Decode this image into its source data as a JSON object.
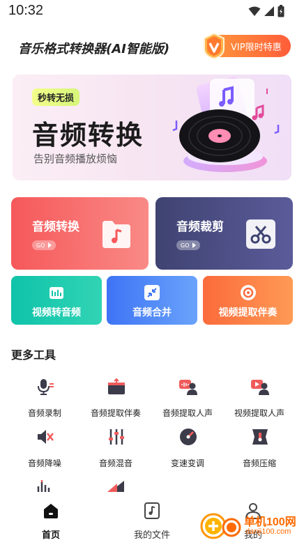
{
  "status_bar": {
    "time": "10:32"
  },
  "header": {
    "app_title": "音乐格式转换器(AI智能版)",
    "vip_label": "VIP限时特惠"
  },
  "banner": {
    "tag": "秒转无损",
    "title": "音频转换",
    "subtitle": "告别音频播放烦恼"
  },
  "main_cards": [
    {
      "title": "音频转换",
      "go": "GO",
      "icon": "folder-music-icon"
    },
    {
      "title": "音频裁剪",
      "go": "GO",
      "icon": "scissors-icon"
    }
  ],
  "quick_tools": [
    {
      "label": "视频转音频",
      "icon": "video-to-audio-icon"
    },
    {
      "label": "音频合并",
      "icon": "merge-icon"
    },
    {
      "label": "视频提取伴奏",
      "icon": "extract-accompaniment-icon"
    }
  ],
  "more_tools": {
    "title": "更多工具",
    "items": [
      {
        "label": "音频录制",
        "icon": "microphone-icon"
      },
      {
        "label": "音频提取伴奏",
        "icon": "audio-box-icon"
      },
      {
        "label": "音频提取人声",
        "icon": "voice-extract-icon"
      },
      {
        "label": "视频提取人声",
        "icon": "video-voice-icon"
      },
      {
        "label": "音频降噪",
        "icon": "noise-reduction-icon"
      },
      {
        "label": "音频混音",
        "icon": "mixer-icon"
      },
      {
        "label": "变速变调",
        "icon": "pitch-icon"
      },
      {
        "label": "音频压缩",
        "icon": "compress-icon"
      }
    ]
  },
  "bottom_nav": {
    "items": [
      {
        "label": "首页",
        "icon": "home-icon",
        "active": true
      },
      {
        "label": "我的文件",
        "icon": "file-music-icon",
        "active": false
      },
      {
        "label": "我的",
        "icon": "user-icon",
        "active": false
      }
    ]
  },
  "watermark": {
    "title": "单机100网",
    "url": "danji100.com"
  },
  "colors": {
    "primary_red": "#f6585a",
    "navy": "#3f4371",
    "teal": "#0fc3aa",
    "blue": "#3e74f5",
    "orange": "#fb6b3b"
  }
}
